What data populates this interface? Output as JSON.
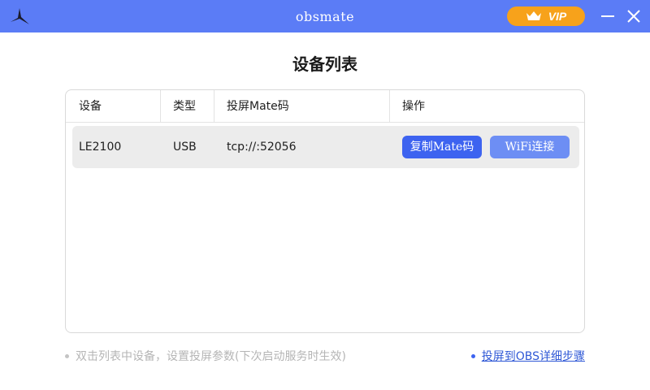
{
  "app": {
    "title": "obsmate",
    "vip_label": "VIP"
  },
  "page": {
    "title": "设备列表"
  },
  "table": {
    "headers": [
      "设备",
      "类型",
      "投屏Mate码",
      "操作"
    ],
    "rows": [
      {
        "device": "LE2100",
        "type": "USB",
        "mate_code": "tcp://:52056",
        "copy_label": "复制Mate码",
        "wifi_label": "WiFi连接"
      }
    ]
  },
  "footer": {
    "hint": "双击列表中设备，设置投屏参数(下次启动服务时生效)",
    "help_link": "投屏到OBS详细步骤"
  },
  "colors": {
    "titlebar": "#5b7cf6",
    "vip": "#f7a21b",
    "primary": "#3d63f0",
    "secondary": "#6d8ef4",
    "row_bg": "#ececec"
  },
  "icons": {
    "logo": "bird-logo-icon",
    "vip": "crown-icon",
    "minimize": "minimize-icon",
    "close": "close-icon"
  }
}
